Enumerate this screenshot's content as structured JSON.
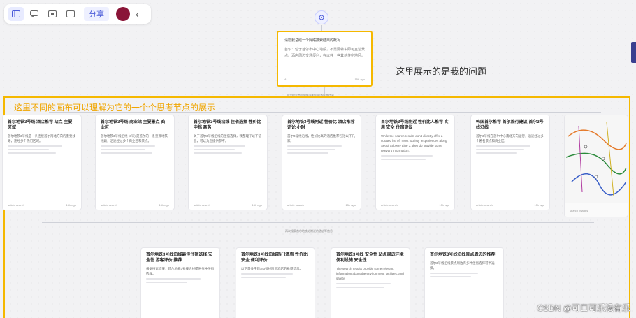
{
  "toolbar": {
    "share_label": "分享",
    "avatar_color": "#8a1538",
    "icons": [
      "sidebar-icon",
      "chat-icon",
      "canvas-icon",
      "grid-icon",
      "chevron-left-icon"
    ]
  },
  "question_card": {
    "title": "请帮我总结一个网络搜索结果的概况",
    "body": "首尔：位于首尔市中心地段，不需要转车即可直达景点。酒店周边交通便利，在以往一些其他住宿地区。",
    "footer_left": "AI",
    "footer_right": "15h ago"
  },
  "annotations": {
    "question_note": "这里展示的是我的问题",
    "region_note": "这里不同的画布可以理解为它的一个个思考节点的展示"
  },
  "labels": {
    "row1_connector": "再次搜索首尔地铁站附近的酒店等信息",
    "row2_connector": "再次搜索首尔地铁站附近的酒店等信息"
  },
  "cards_row1": [
    {
      "title": "首尔地铁3号线 酒店推荐 站点 主要区域",
      "body": "首尔地铁3号线是一条连接首尔南北方向的重要线路，途经多个热门区域。",
      "foot_left": "article search",
      "foot_right": "15h ago"
    },
    {
      "title": "首尔地铁3号线 商业站 主要景点 商业区",
      "body": "首尔地铁3号线沿线 (3号) 是首尔的一条重要地铁线路，沿途经过多个商业区和景点。",
      "foot_left": "article search",
      "foot_right": "15h ago"
    },
    {
      "title": "首尔地铁3号线沿线 住宿选择 性价比 中档 商务",
      "body": "关于首尔3号线沿线的住宿选择，我整理了以下信息，可以为您提供参考。",
      "foot_left": "article search",
      "foot_right": "15h ago"
    },
    {
      "title": "首尔地铁3号线附近 性价比 酒店推荐 评论 小时",
      "body": "首尔3号线沿线，性价比高的酒店推荐包括以下几家。",
      "foot_left": "article search",
      "foot_right": "15h ago"
    },
    {
      "title": "首尔地铁3号线附近 性价比人推荐 实用 安全 住宿建议",
      "body": "While the search results don't directly offer a curated list of \"most touristy\" experiences along Seoul Subway Line 3, they do provide some relevant information.",
      "foot_left": "article search",
      "foot_right": "15h ago"
    },
    {
      "title": "韩国首尔推荐 首尔旅行建议 首尔3号线沿线",
      "body": "首尔3号线在首尔中心南北方向运行，沿途经过多个著名景点和商业区。",
      "foot_left": "article search",
      "foot_right": "15h ago"
    },
    {
      "title": "",
      "body": "",
      "foot_left": "search Images",
      "foot_right": ""
    }
  ],
  "cards_row2": [
    {
      "title": "首尔地铁3号线沿线最佳住宿选择 安全性 游客评价 推荐",
      "body": "根据搜索结果，首尔地铁3号线沿线提供多种住宿选择。",
      "foot_left": "article search",
      "foot_right": "15h ago"
    },
    {
      "title": "首尔地铁3号线沿线热门酒店 性价比 安全 便利评价",
      "body": "以下是关于首尔3号线附近酒店的推荐信息。",
      "foot_left": "article search",
      "foot_right": "15h ago"
    },
    {
      "title": "首尔地铁3号线 安全性 站点周边环境 便利设施 安全性",
      "body": "The search results provide some relevant information about the environment, facilities, and safety.",
      "foot_left": "article search",
      "foot_right": "15h ago"
    },
    {
      "title": "首尔地铁3号线沿线景点周边的推荐",
      "body": "首尔3号线沿线景点周边有多种住宿选择可供选择。",
      "foot_left": "article search",
      "foot_right": "15h ago"
    }
  ],
  "watermark": "CSDN @可口可乐没有乐",
  "colors": {
    "highlight_border": "#f5b800",
    "annotation_orange": "#f0a500",
    "accent": "#4b5bd9"
  }
}
